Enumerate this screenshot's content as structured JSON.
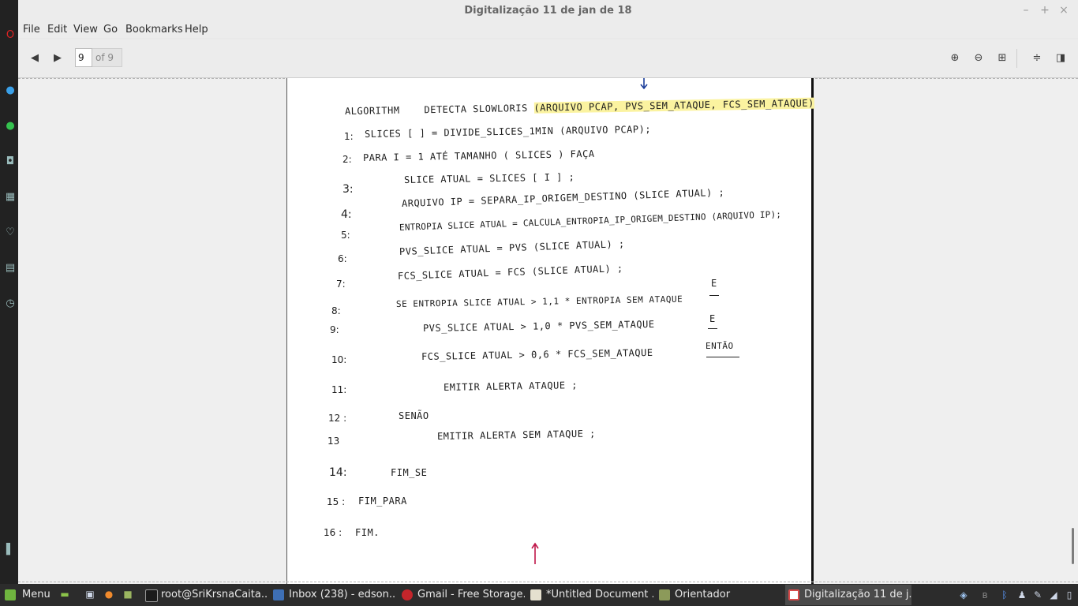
{
  "window": {
    "title": "Digitalização 11 de jan de 18",
    "controls": {
      "minimize": "–",
      "maximize": "+",
      "close": "×"
    }
  },
  "menubar": {
    "items": [
      "File",
      "Edit",
      "View",
      "Go",
      "Bookmarks",
      "Help"
    ]
  },
  "toolbar": {
    "page_current": "9",
    "page_total": "of 9"
  },
  "document": {
    "header": {
      "keyword": "ALGORITHM",
      "name": "DETECTA SLOWLORIS",
      "params": "(ARQUIVO PCAP, PVS_SEM_ATAQUE, FCS_SEM_ATAQUE)"
    },
    "lines": [
      {
        "num": "1:",
        "text": "SLICES [ ] = DIVIDE_SLICES_1MIN (ARQUIVO PCAP);"
      },
      {
        "num": "2:",
        "text": "PARA  I = 1   ATÉ  TAMANHO ( SLICES )    FAÇA"
      },
      {
        "num": "3:",
        "text": "SLICE ATUAL = SLICES [ I ] ;"
      },
      {
        "num": "4:",
        "text": "ARQUIVO IP  =  SEPARA_IP_ORIGEM_DESTINO (SLICE ATUAL) ;"
      },
      {
        "num": "5:",
        "text": "ENTROPIA SLICE ATUAL = CALCULA_ENTROPIA_IP_ORIGEM_DESTINO (ARQUIVO IP);"
      },
      {
        "num": "6:",
        "text": "PVS_SLICE ATUAL  =  PVS (SLICE ATUAL) ;"
      },
      {
        "num": "7:",
        "text": "FCS_SLICE ATUAL  =  FCS (SLICE ATUAL) ;"
      },
      {
        "num": "8:",
        "text": "SE   ENTROPIA SLICE ATUAL  >  1,1  * ENTROPIA SEM ATAQUE"
      },
      {
        "num": "9:",
        "text": "PVS_SLICE ATUAL  >  1,0  * PVS_SEM_ATAQUE"
      },
      {
        "num": "10:",
        "text": "FCS_SLICE ATUAL  >  0,6  * FCS_SEM_ATAQUE"
      },
      {
        "num": "11:",
        "text": "EMITIR ALERTA ATAQUE ;"
      },
      {
        "num": "12 :",
        "text": "SENÃO"
      },
      {
        "num": "13",
        "text": "EMITIR ALERTA SEM ATAQUE ;"
      },
      {
        "num": "14:",
        "text": "FIM_SE"
      },
      {
        "num": "15 :",
        "text": "FIM_PARA"
      },
      {
        "num": "16 :",
        "text": "FIM."
      }
    ],
    "conj_e1": "E",
    "conj_e2": "E",
    "conj_entao": "ENTÃO"
  },
  "taskbar": {
    "menu_label": "Menu",
    "tasks": [
      {
        "label": "root@SriKrsnaCaita...",
        "color": "#1b1b1b"
      },
      {
        "label": "Inbox (238) - edson...",
        "color": "#3e6fb5"
      },
      {
        "label": "Gmail - Free Storage...",
        "color": "#c4252b"
      },
      {
        "label": "*Untitled Document ...",
        "color": "#e5e0cf"
      },
      {
        "label": "Orientador",
        "color": "#8c9a5a"
      },
      {
        "label": "Digitalização 11 de j...",
        "color": "#d84b4b"
      }
    ]
  }
}
